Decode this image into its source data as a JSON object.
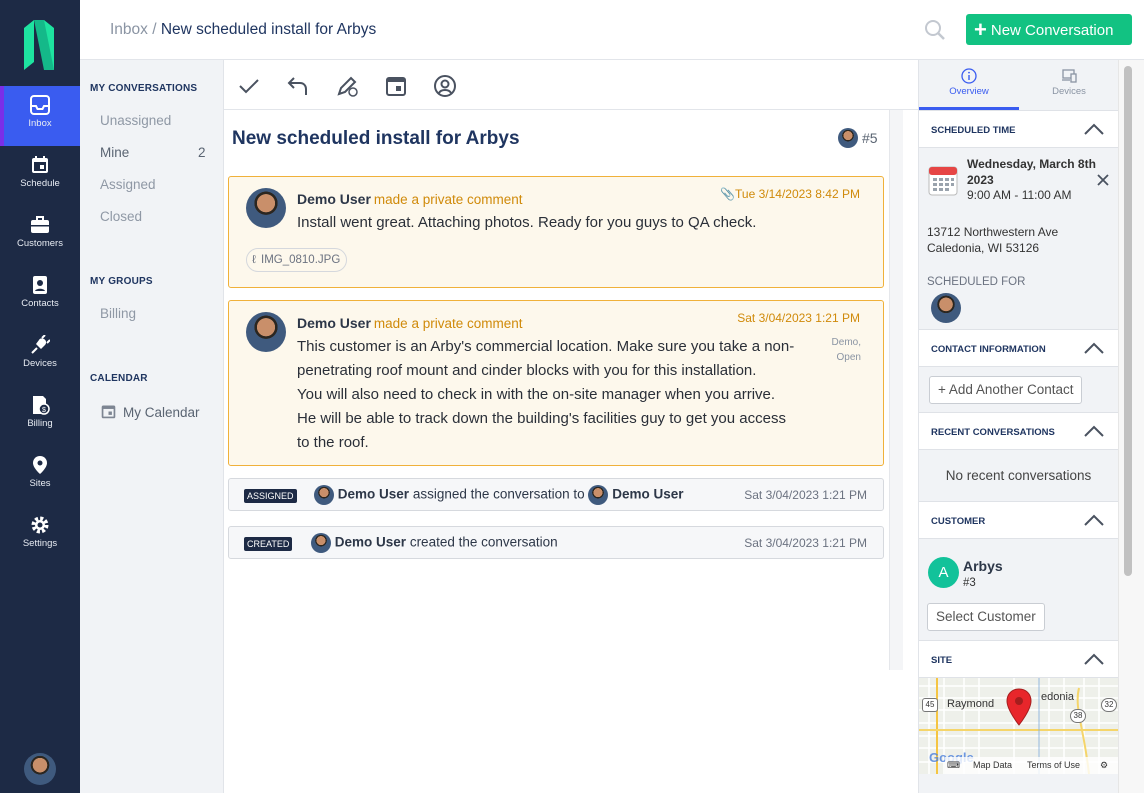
{
  "breadcrumb": {
    "root": "Inbox /",
    "current": "New scheduled install for Arbys"
  },
  "header": {
    "new_button": "New Conversation"
  },
  "nav": [
    {
      "label": "Inbox",
      "icon": "inbox-icon"
    },
    {
      "label": "Schedule",
      "icon": "calendar-icon"
    },
    {
      "label": "Customers",
      "icon": "briefcase-icon"
    },
    {
      "label": "Contacts",
      "icon": "contact-card-icon"
    },
    {
      "label": "Devices",
      "icon": "plug-icon"
    },
    {
      "label": "Billing",
      "icon": "billing-icon"
    },
    {
      "label": "Sites",
      "icon": "location-pin-icon"
    },
    {
      "label": "Settings",
      "icon": "gear-icon"
    }
  ],
  "sidebar": {
    "my_conversations": "MY CONVERSATIONS",
    "items": [
      "Unassigned",
      "Mine",
      "Assigned",
      "Closed"
    ],
    "mine_count": "2",
    "my_groups": "MY GROUPS",
    "groups": [
      "Billing"
    ],
    "calendar": "CALENDAR",
    "calendar_item": "My Calendar"
  },
  "conversation": {
    "title": "New scheduled install for Arbys",
    "number": "#5",
    "comments": [
      {
        "author": "Demo User",
        "action": "made a private comment",
        "date": "Tue 3/14/2023 8:42 PM",
        "text": "Install went great. Attaching photos. Ready for you guys to QA check.",
        "attachment": "IMG_0810.JPG"
      },
      {
        "author": "Demo User",
        "action": "made a private comment",
        "date": "Sat 3/04/2023 1:21 PM",
        "lines": [
          "This customer is an Arby's commercial location. Make sure you take a non-",
          "penetrating roof mount and cinder blocks with you for this installation.",
          "You will also need to check in with the on-site manager when you arrive.",
          "He will be able to track down the building's facilities guy to get you access",
          "to the roof."
        ],
        "meta1": "Demo,",
        "meta2": "Open"
      }
    ],
    "events": [
      {
        "tag": "ASSIGNED",
        "actor": "Demo User",
        "action": "assigned the conversation to",
        "target": "Demo User",
        "time": "Sat 3/04/2023 1:21 PM"
      },
      {
        "tag": "CREATED",
        "actor": "Demo User",
        "action": "created the conversation",
        "time": "Sat 3/04/2023 1:21 PM"
      }
    ]
  },
  "right": {
    "tabs": [
      "Overview",
      "Devices"
    ],
    "scheduled_time": "SCHEDULED TIME",
    "date_line1": "Wednesday, March 8th",
    "date_line2": "2023",
    "time_range": "9:00 AM - 11:00 AM",
    "address1": "13712 Northwestern Ave",
    "address2": "Caledonia, WI 53126",
    "scheduled_for": "SCHEDULED FOR",
    "contact_info": "CONTACT INFORMATION",
    "add_contact": "+ Add Another Contact",
    "recent": "RECENT CONVERSATIONS",
    "no_recent": "No recent conversations",
    "customer": "CUSTOMER",
    "customer_initial": "A",
    "customer_name": "Arbys",
    "customer_num": "#3",
    "select_customer": "Select Customer",
    "site": "SITE",
    "map_labels": {
      "raymond": "Raymond",
      "caledonia": "edonia",
      "r45": "45",
      "r38": "38",
      "r32": "32",
      "google": "Google",
      "map_data": "Map Data",
      "terms": "Terms of Use"
    }
  },
  "colors": {
    "nav_bg": "#1d2a45",
    "accent": "#3a5cf0",
    "green": "#12c282",
    "comment_border": "#f0b13a",
    "comment_action": "#d08a0a",
    "title": "#1f3560"
  }
}
